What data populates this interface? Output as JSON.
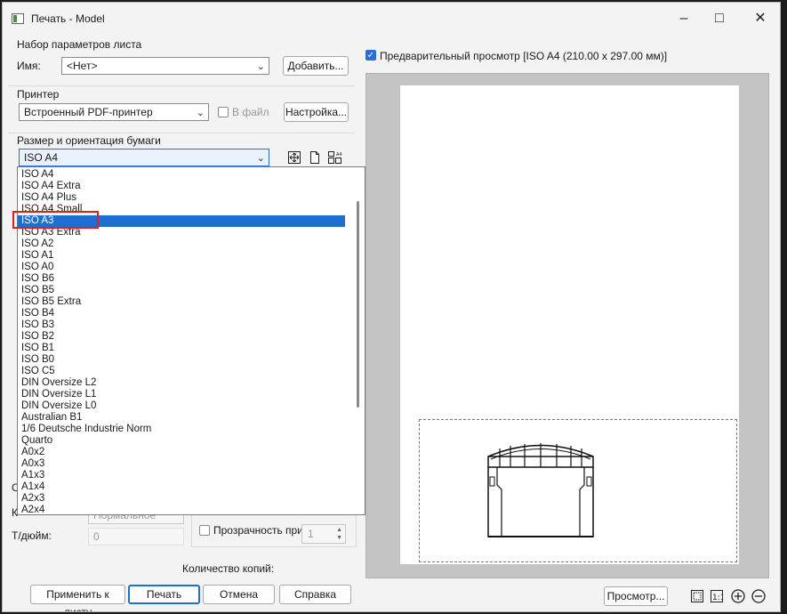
{
  "window": {
    "title": "Печать - Model",
    "controls": [
      "minimize",
      "maximize",
      "close"
    ]
  },
  "page_setup": {
    "group_label": "Набор параметров листа",
    "name_label": "Имя:",
    "name_value": "<Нет>",
    "add_button": "Добавить..."
  },
  "printer": {
    "group_label": "Принтер",
    "printer_value": "Встроенный PDF-принтер",
    "to_file_label": "В файл",
    "settings_button": "Настройка..."
  },
  "paper": {
    "group_label": "Размер и ориентация бумаги",
    "size_value": "ISO A4",
    "options": [
      "ISO A4",
      "ISO A4 Extra",
      "ISO A4 Plus",
      "ISO A4 Small",
      "ISO A3",
      "ISO A3 Extra",
      "ISO A2",
      "ISO A1",
      "ISO A0",
      "ISO B6",
      "ISO B5",
      "ISO B5 Extra",
      "ISO B4",
      "ISO B3",
      "ISO B2",
      "ISO B1",
      "ISO B0",
      "ISO C5",
      "DIN Oversize L2",
      "DIN Oversize L1",
      "DIN Oversize L0",
      "Australian B1",
      "1/6 Deutsche Industrie Norm",
      "Quarto",
      "A0x2",
      "A0x3",
      "A1x3",
      "A1x4",
      "A2x3",
      "A2x4"
    ],
    "selected_index": 4,
    "icons": [
      "fit-icon",
      "portrait-page-icon",
      "page-size-icon"
    ]
  },
  "quality": {
    "dpi_label": "Т/дюйм:",
    "dpi_value": "0",
    "quality_value": "Нормальное",
    "transparency_label": "Прозрачность при печати"
  },
  "copies": {
    "label": "Количество копий:",
    "value": "1"
  },
  "footer": {
    "apply_button": "Применить к листу",
    "print_button": "Печать",
    "cancel_button": "Отмена",
    "help_button": "Справка"
  },
  "preview": {
    "checkbox_label": "Предварительный просмотр [ISO A4 (210.00 x 297.00 мм)]",
    "checked": true,
    "preview_button": "Просмотр...",
    "tools": [
      "fit-page-icon",
      "actual-size-icon",
      "zoom-in-icon",
      "zoom-out-icon"
    ]
  },
  "colors": {
    "accent": "#1e6fd0",
    "highlight_box": "#e02020"
  }
}
